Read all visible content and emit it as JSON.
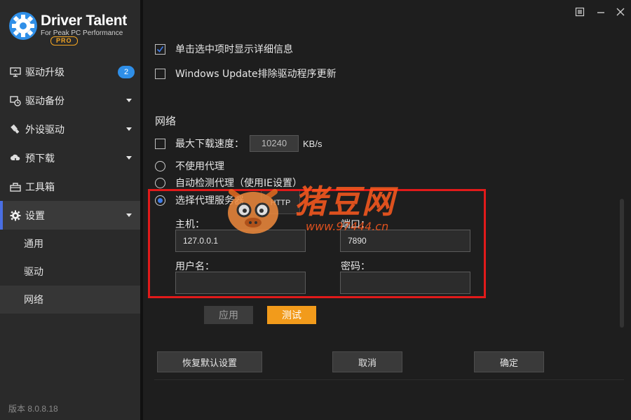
{
  "app": {
    "brand": "Driver Talent",
    "tagline": "For Peak PC Performance",
    "edition": "PRO",
    "version": "版本 8.0.8.18"
  },
  "sidebar": {
    "items": [
      {
        "label": "驱动升级",
        "icon": "monitor-icon",
        "badge": "2"
      },
      {
        "label": "驱动备份",
        "icon": "backup-clock-icon"
      },
      {
        "label": "外设驱动",
        "icon": "usb-icon"
      },
      {
        "label": "预下载",
        "icon": "cloud-download-icon"
      },
      {
        "label": "工具箱",
        "icon": "toolbox-icon"
      },
      {
        "label": "设置",
        "icon": "gear-icon"
      }
    ],
    "sub_items": [
      {
        "label": "通用"
      },
      {
        "label": "驱动"
      },
      {
        "label": "网络"
      }
    ]
  },
  "settings": {
    "show_details_label": "单击选中项时显示详细信息",
    "show_details_checked": true,
    "windows_update_label": "Windows Update排除驱动程序更新",
    "windows_update_checked": false,
    "network_section": "网络",
    "max_speed_label": "最大下载速度：",
    "max_speed_checked": false,
    "max_speed_value": "10240",
    "max_speed_unit": "KB/s",
    "proxy_options": [
      {
        "label": "不使用代理",
        "selected": false
      },
      {
        "label": "自动检测代理（使用IE设置）",
        "selected": false
      },
      {
        "label": "选择代理服务器",
        "selected": true
      }
    ],
    "proxy_type": "HTTP",
    "host_label": "主机：",
    "host_value": "127.0.0.1",
    "port_label": "端口：",
    "port_value": "7890",
    "username_label": "用户名：",
    "username_value": "",
    "password_label": "密码：",
    "password_value": ""
  },
  "buttons": {
    "apply": "应用",
    "test": "测试",
    "restore": "恢复默认设置",
    "cancel": "取消",
    "ok": "确定"
  },
  "watermark": {
    "text": "猪豆网",
    "url": "www.97444.cn"
  },
  "colors": {
    "accent_blue": "#2f8fe8",
    "test_orange": "#f29b1b",
    "highlight_red": "#e11a1a",
    "watermark_orange": "#ff5a1f"
  }
}
